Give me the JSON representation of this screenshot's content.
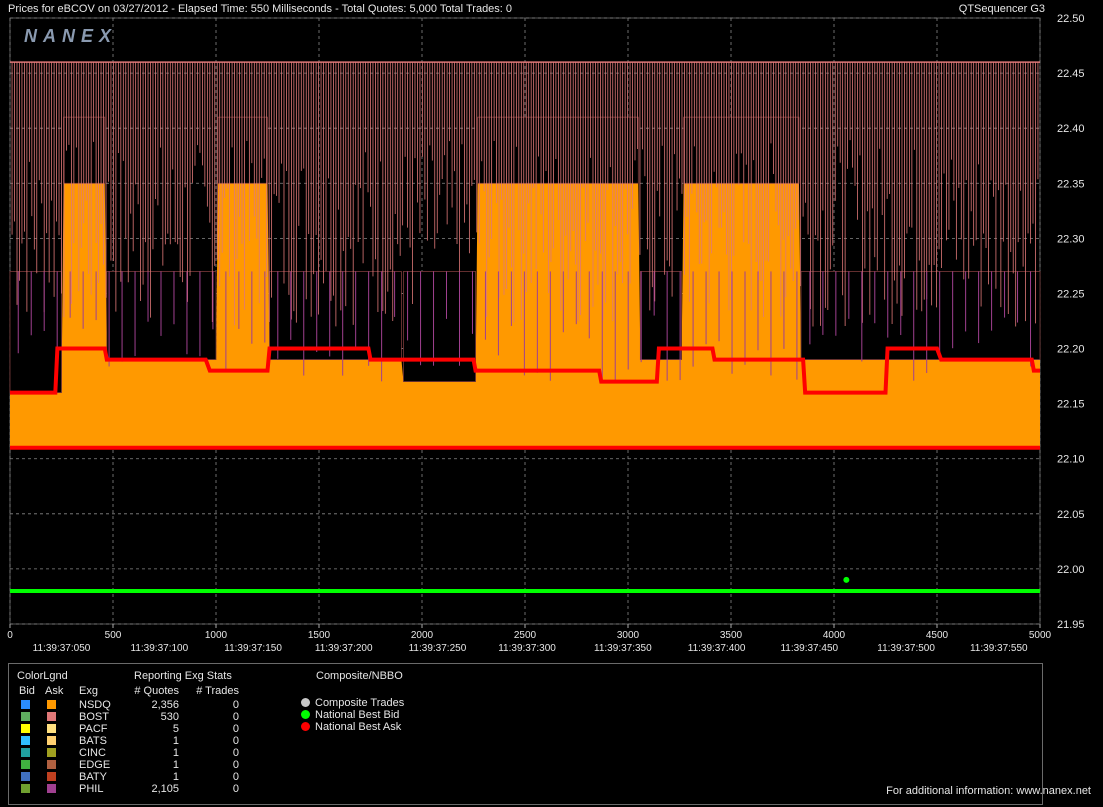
{
  "header": {
    "title": "Prices for  eBCOV  on  03/27/2012  -  Elapsed Time: 550 Milliseconds  -  Total Quotes: 5,000  Total Trades: 0",
    "app": "QTSequencer G3",
    "logo": "NANEX"
  },
  "colors": {
    "ask_fill": "#ff9900",
    "best_ask": "#ff0000",
    "best_bid": "#00ff00",
    "boston_ask": "#e07878",
    "phil_ask": "#a04090",
    "grid": "#888888"
  },
  "chart_data": {
    "type": "line",
    "x_range": [
      0,
      5000
    ],
    "y_range": [
      21.95,
      22.5
    ],
    "x_ticks": [
      0,
      500,
      1000,
      1500,
      2000,
      2500,
      3000,
      3500,
      4000,
      4500,
      5000
    ],
    "x_time_labels": [
      {
        "x": 250,
        "label": "11:39:37:050"
      },
      {
        "x": 725,
        "label": "11:39:37:100"
      },
      {
        "x": 1180,
        "label": "11:39:37:150"
      },
      {
        "x": 1620,
        "label": "11:39:37:200"
      },
      {
        "x": 2075,
        "label": "11:39:37:250"
      },
      {
        "x": 2510,
        "label": "11:39:37:300"
      },
      {
        "x": 2975,
        "label": "11:39:37:350"
      },
      {
        "x": 3430,
        "label": "11:39:37:400"
      },
      {
        "x": 3880,
        "label": "11:39:37:450"
      },
      {
        "x": 4350,
        "label": "11:39:37:500"
      },
      {
        "x": 4800,
        "label": "11:39:37:550"
      }
    ],
    "y_ticks": [
      "21.95",
      "22.00",
      "22.05",
      "22.10",
      "22.15",
      "22.20",
      "22.25",
      "22.30",
      "22.35",
      "22.40",
      "22.45",
      "22.50"
    ],
    "grid": true,
    "series": [
      {
        "name": "National Best Bid",
        "x": [
          0,
          5000
        ],
        "values": [
          21.98,
          21.98
        ]
      },
      {
        "name": "National Best Ask",
        "x": [
          0,
          220,
          230,
          460,
          470,
          950,
          970,
          1250,
          1260,
          1740,
          1750,
          2250,
          2260,
          2860,
          2870,
          3140,
          3150,
          3410,
          3420,
          3850,
          3860,
          4250,
          4260,
          4500,
          4520,
          4960,
          4970,
          5000
        ],
        "values": [
          22.16,
          22.16,
          22.2,
          22.2,
          22.19,
          22.19,
          22.18,
          22.18,
          22.2,
          22.2,
          22.19,
          22.19,
          22.18,
          22.18,
          22.17,
          22.17,
          22.2,
          22.2,
          22.19,
          22.19,
          22.16,
          22.16,
          22.2,
          22.2,
          22.19,
          22.19,
          22.18,
          22.18
        ]
      },
      {
        "name": "NSDQ Ask",
        "x": [
          0,
          250,
          260,
          460,
          470,
          1000,
          1010,
          1250,
          1260,
          1900,
          1910,
          2260,
          2270,
          3050,
          3060,
          3260,
          3270,
          3830,
          3840,
          5000
        ],
        "values": [
          22.16,
          22.16,
          22.35,
          22.35,
          22.19,
          22.19,
          22.35,
          22.35,
          22.19,
          22.19,
          22.17,
          22.17,
          22.35,
          22.35,
          22.19,
          22.19,
          22.35,
          22.35,
          22.19,
          22.19
        ]
      },
      {
        "name": "Boston Ask",
        "x": [
          0,
          5000
        ],
        "values": [
          22.46,
          22.46
        ]
      }
    ],
    "markers": [
      {
        "name": "Best Bid Marker",
        "x": 4060,
        "y": 21.99
      }
    ]
  },
  "legend": {
    "colorlgnd_title": "ColorLgnd",
    "bid_header": "Bid",
    "ask_header": "Ask",
    "stats_title": "Reporting Exg Stats",
    "exg_header": "Exg",
    "quotes_header": "# Quotes",
    "trades_header": "# Trades",
    "rows": [
      {
        "exg": "NSDQ",
        "quotes": "2,356",
        "trades": "0",
        "bid_color": "#2a8cff",
        "ask_color": "#ff9900"
      },
      {
        "exg": "BOST",
        "quotes": "530",
        "trades": "0",
        "bid_color": "#5fae5f",
        "ask_color": "#e07878"
      },
      {
        "exg": "PACF",
        "quotes": "5",
        "trades": "0",
        "bid_color": "#ffff00",
        "ask_color": "#ffe080"
      },
      {
        "exg": "BATS",
        "quotes": "1",
        "trades": "0",
        "bid_color": "#30c0ff",
        "ask_color": "#ffd070"
      },
      {
        "exg": "CINC",
        "quotes": "1",
        "trades": "0",
        "bid_color": "#20a0a0",
        "ask_color": "#a0a020"
      },
      {
        "exg": "EDGE",
        "quotes": "1",
        "trades": "0",
        "bid_color": "#40b040",
        "ask_color": "#b06040"
      },
      {
        "exg": "BATY",
        "quotes": "1",
        "trades": "0",
        "bid_color": "#4070c0",
        "ask_color": "#c04020"
      },
      {
        "exg": "PHIL",
        "quotes": "2,105",
        "trades": "0",
        "bid_color": "#70a030",
        "ask_color": "#a04090"
      }
    ],
    "composite_title": "Composite/NBBO",
    "composite_items": [
      {
        "label": "Composite Trades",
        "color": "#c8c8c8"
      },
      {
        "label": "National Best Bid",
        "color": "#00ff00"
      },
      {
        "label": "National Best Ask",
        "color": "#ff0000"
      }
    ]
  },
  "footer": "For additional information: www.nanex.net"
}
